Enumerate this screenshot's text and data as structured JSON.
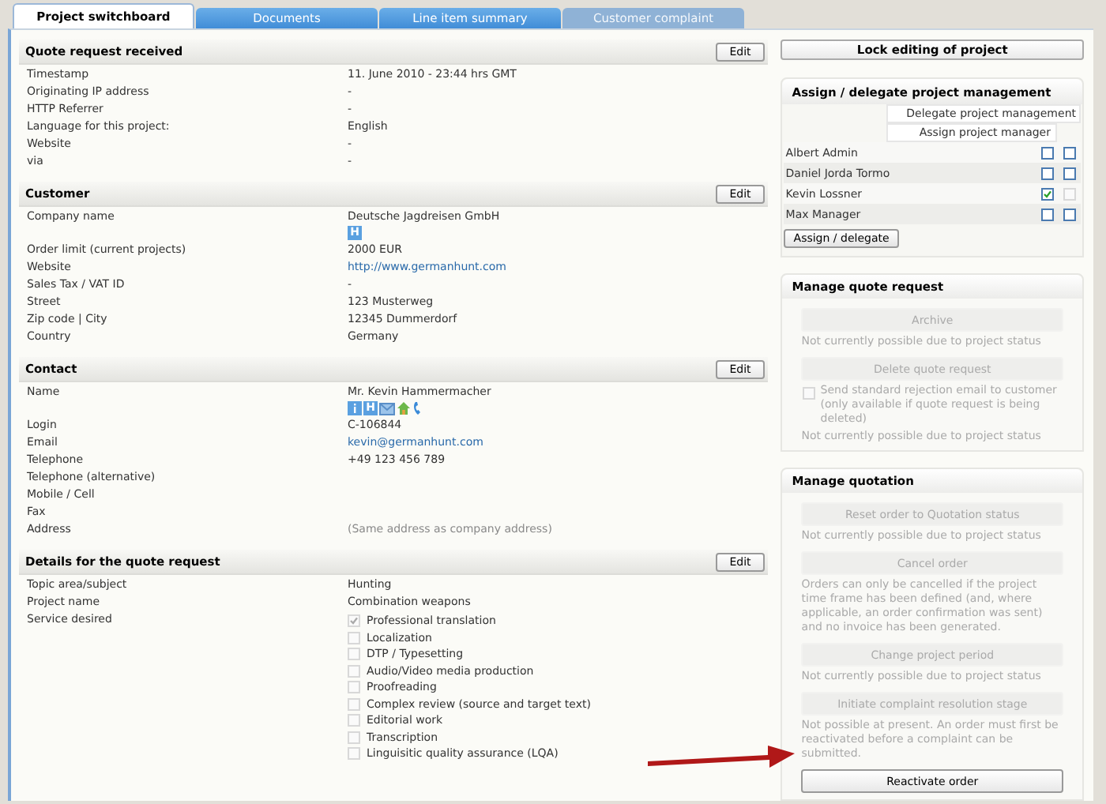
{
  "tabs": [
    {
      "label": "Project switchboard",
      "selected": true,
      "disabled": false
    },
    {
      "label": "Documents",
      "selected": false,
      "disabled": false
    },
    {
      "label": "Line item summary",
      "selected": false,
      "disabled": false
    },
    {
      "label": "Customer complaint",
      "selected": false,
      "disabled": true
    }
  ],
  "sections": [
    {
      "title": "Quote request received",
      "edit": "Edit",
      "rows": [
        {
          "label": "Timestamp",
          "value": "11. June 2010 - 23:44 hrs GMT",
          "kind": "text"
        },
        {
          "label": "Originating IP address",
          "value": "-",
          "kind": "text"
        },
        {
          "label": "HTTP Referrer",
          "value": "-",
          "kind": "text"
        },
        {
          "label": "Language for this project:",
          "value": "English",
          "kind": "text"
        },
        {
          "label": "Website",
          "value": "-",
          "kind": "text"
        },
        {
          "label": "via",
          "value": "-",
          "kind": "text"
        }
      ]
    },
    {
      "title": "Customer",
      "edit": "Edit",
      "rows": [
        {
          "label": "Company name",
          "value": "Deutsche Jagdreisen GmbH",
          "kind": "text",
          "icons": [
            {
              "kind": "letter",
              "text": "H"
            }
          ]
        },
        {
          "label": "Order limit (current projects)",
          "value": "2000 EUR",
          "kind": "text"
        },
        {
          "label": "Website",
          "value": "http://www.germanhunt.com",
          "kind": "link"
        },
        {
          "label": "Sales Tax / VAT ID",
          "value": "-",
          "kind": "text"
        },
        {
          "label": "Street",
          "value": "123 Musterweg",
          "kind": "text"
        },
        {
          "label": "Zip code | City",
          "value": "12345 Dummerdorf",
          "kind": "text"
        },
        {
          "label": "Country",
          "value": "Germany",
          "kind": "text"
        }
      ]
    },
    {
      "title": "Contact",
      "edit": "Edit",
      "rows": [
        {
          "label": "Name",
          "value": "Mr. Kevin Hammermacher",
          "kind": "text",
          "icons": [
            {
              "kind": "info"
            },
            {
              "kind": "letter",
              "text": "H"
            },
            {
              "kind": "mail"
            },
            {
              "kind": "house"
            },
            {
              "kind": "phone"
            }
          ]
        },
        {
          "label": "Login",
          "value": "C-106844",
          "kind": "text"
        },
        {
          "label": "Email",
          "value": "kevin@germanhunt.com",
          "kind": "link"
        },
        {
          "label": "Telephone",
          "value": "+49 123 456 789",
          "kind": "text"
        },
        {
          "label": "Telephone (alternative)",
          "kind": "text"
        },
        {
          "label": "Mobile / Cell",
          "kind": "text"
        },
        {
          "label": "Fax",
          "kind": "text"
        },
        {
          "label": "Address",
          "value": "(Same address as company address)",
          "kind": "muted"
        }
      ]
    },
    {
      "title": "Details for the quote request",
      "edit": "Edit",
      "rows": [
        {
          "label": "Topic area/subject",
          "value": "Hunting",
          "kind": "text"
        },
        {
          "label": "Project name",
          "value": "Combination weapons",
          "kind": "text"
        },
        {
          "label": "Service desired",
          "kind": "checklist",
          "options": [
            {
              "label": "Professional translation",
              "checked": true
            },
            {
              "label": "Localization",
              "checked": false
            },
            {
              "label": "DTP / Typesetting",
              "checked": false
            },
            {
              "label": "Audio/Video media production",
              "checked": false
            },
            {
              "label": "Proofreading",
              "checked": false
            },
            {
              "label": "Complex review (source and target text)",
              "checked": false
            },
            {
              "label": "Editorial work",
              "checked": false
            },
            {
              "label": "Transcription",
              "checked": false
            },
            {
              "label": "Linguisitic quality assurance (LQA)",
              "checked": false
            }
          ]
        }
      ]
    }
  ],
  "lock_button": "Lock editing of project",
  "assign": {
    "title": "Assign / delegate project management",
    "column_delegate": "Delegate project management",
    "column_assign": "Assign project manager",
    "users": [
      {
        "name": "Albert Admin",
        "assign": false,
        "delegate": false,
        "delegate_disabled": false
      },
      {
        "name": "Daniel Jorda Tormo",
        "assign": false,
        "delegate": false,
        "delegate_disabled": false
      },
      {
        "name": "Kevin Lossner",
        "assign": true,
        "delegate": false,
        "delegate_disabled": true
      },
      {
        "name": "Max Manager",
        "assign": false,
        "delegate": false,
        "delegate_disabled": false
      }
    ],
    "button": "Assign / delegate"
  },
  "panels": [
    {
      "title": "Manage quote request",
      "items": [
        {
          "kind": "button",
          "label": "Archive",
          "disabled": true
        },
        {
          "kind": "note",
          "text": "Not currently possible due to project status"
        },
        {
          "kind": "button",
          "label": "Delete quote request",
          "disabled": true
        },
        {
          "kind": "checkbox",
          "label": "Send standard rejection email to customer (only available if quote request is being deleted)",
          "checked": false
        },
        {
          "kind": "note",
          "text": "Not currently possible due to project status"
        }
      ]
    },
    {
      "title": "Manage quotation",
      "items": [
        {
          "kind": "button",
          "label": "Reset order to Quotation status",
          "disabled": true
        },
        {
          "kind": "note",
          "text": "Not currently possible due to project status"
        },
        {
          "kind": "button",
          "label": "Cancel order",
          "disabled": true
        },
        {
          "kind": "note",
          "text": "Orders can only be cancelled if the project time frame has been defined (and, where applicable, an order confirmation was sent) and no invoice has been generated."
        },
        {
          "kind": "button",
          "label": "Change project period",
          "disabled": true
        },
        {
          "kind": "note",
          "text": "Not currently possible due to project status"
        },
        {
          "kind": "button",
          "label": "Initiate complaint resolution stage",
          "disabled": true
        },
        {
          "kind": "note",
          "text": "Not possible at present. An order must first be reactivated before a complaint can be submitted."
        },
        {
          "kind": "button",
          "label": "Reactivate order",
          "disabled": false
        }
      ]
    }
  ]
}
